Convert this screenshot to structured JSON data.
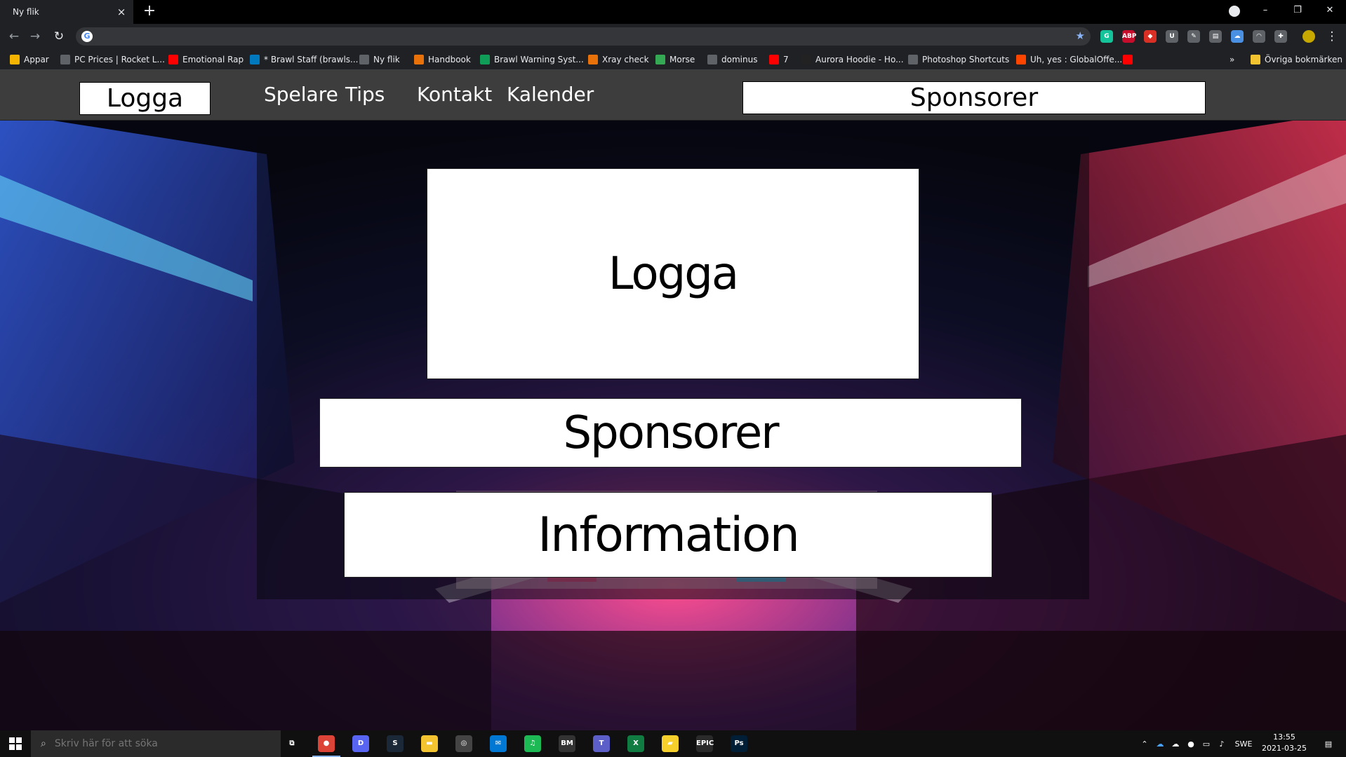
{
  "browser": {
    "tab_title": "Ny flik",
    "tab_close": "×",
    "new_tab": "+",
    "address_value": "",
    "window_controls": [
      "–",
      "❐",
      "✕"
    ],
    "extensions": [
      {
        "name": "grammarly-icon",
        "label": "G",
        "color": "#15c39a"
      },
      {
        "name": "adblock-icon",
        "label": "ABP",
        "color": "#c70d2c"
      },
      {
        "name": "ext-red-icon",
        "label": "◆",
        "color": "#d93025"
      },
      {
        "name": "ublock-icon",
        "label": "U",
        "color": "#5f6368"
      },
      {
        "name": "pen-icon",
        "label": "✎",
        "color": "#5f6368"
      },
      {
        "name": "clipboard-icon",
        "label": "▤",
        "color": "#5f6368"
      },
      {
        "name": "cloud-ext-icon",
        "label": "☁",
        "color": "#4a90e2"
      },
      {
        "name": "mask-icon",
        "label": "◠",
        "color": "#5f6368"
      },
      {
        "name": "puzzle-icon",
        "label": "✚",
        "color": "#5f6368"
      }
    ]
  },
  "bookmarks": {
    "items": [
      {
        "label": "Appar",
        "icon": "apps-grid-icon",
        "color": "#f4b400"
      },
      {
        "label": "PC Prices | Rocket L...",
        "icon": "pencil-icon",
        "color": "#5f6368"
      },
      {
        "label": "Emotional Rap",
        "icon": "youtube-icon",
        "color": "#ff0000"
      },
      {
        "label": "* Brawl Staff (brawls...",
        "icon": "trello-icon",
        "color": "#0079bf"
      },
      {
        "label": "Ny flik",
        "icon": "globe-icon",
        "color": "#5f6368"
      },
      {
        "label": "Handbook",
        "icon": "arrow-icon",
        "color": "#e8710a"
      },
      {
        "label": "Brawl Warning Syst...",
        "icon": "sheets-icon",
        "color": "#0f9d58"
      },
      {
        "label": "Xray check",
        "icon": "arrow-icon",
        "color": "#e8710a"
      },
      {
        "label": "Morse",
        "icon": "l-icon",
        "color": "#34a853"
      },
      {
        "label": "dominus",
        "icon": "grid-icon",
        "color": "#5f6368"
      },
      {
        "label": "7",
        "icon": "youtube-icon",
        "color": "#ff0000"
      },
      {
        "label": "Aurora Hoodie - Ho...",
        "icon": "hoodie-icon",
        "color": "#222222"
      },
      {
        "label": "Photoshop Shortcuts",
        "icon": "document-icon",
        "color": "#5f6368"
      },
      {
        "label": "Uh, yes : GlobalOffe...",
        "icon": "reddit-icon",
        "color": "#ff4500"
      },
      {
        "label": "",
        "icon": "youtube-icon",
        "color": "#ff0000"
      }
    ],
    "more": "»",
    "other_folder": "Övriga bokmärken"
  },
  "site": {
    "nav": {
      "logo": "Logga",
      "links": [
        "Spelare",
        "Tips",
        "Kontakt",
        "Kalender"
      ],
      "sponsor": "Sponsorer"
    },
    "boxes": {
      "logo": "Logga",
      "sponsors": "Sponsorer",
      "info": "Information"
    }
  },
  "taskbar": {
    "search_placeholder": "Skriv här för att söka",
    "apps": [
      {
        "name": "task-view-icon",
        "label": "⧉",
        "color": "#101010"
      },
      {
        "name": "chrome-icon",
        "label": "●",
        "color": "#db4437",
        "active": true
      },
      {
        "name": "discord-icon",
        "label": "D",
        "color": "#5865f2"
      },
      {
        "name": "steam-icon",
        "label": "S",
        "color": "#1b2838"
      },
      {
        "name": "file-explorer-icon",
        "label": "▬",
        "color": "#f4c430"
      },
      {
        "name": "hub-icon",
        "label": "◎",
        "color": "#444444"
      },
      {
        "name": "mail-icon",
        "label": "✉",
        "color": "#0078d4"
      },
      {
        "name": "spotify-icon",
        "label": "♫",
        "color": "#1db954"
      },
      {
        "name": "bandicam-icon",
        "label": "BM",
        "color": "#333333"
      },
      {
        "name": "teams-icon",
        "label": "T",
        "color": "#5b5fc7"
      },
      {
        "name": "excel-icon",
        "label": "X",
        "color": "#107c41"
      },
      {
        "name": "sticky-notes-icon",
        "label": "▰",
        "color": "#f7d02c"
      },
      {
        "name": "epic-games-icon",
        "label": "EPIC",
        "color": "#2a2a2a"
      },
      {
        "name": "photoshop-icon",
        "label": "Ps",
        "color": "#001e36"
      }
    ],
    "language": "SWE",
    "time": "13:55",
    "date": "2021-03-25"
  }
}
